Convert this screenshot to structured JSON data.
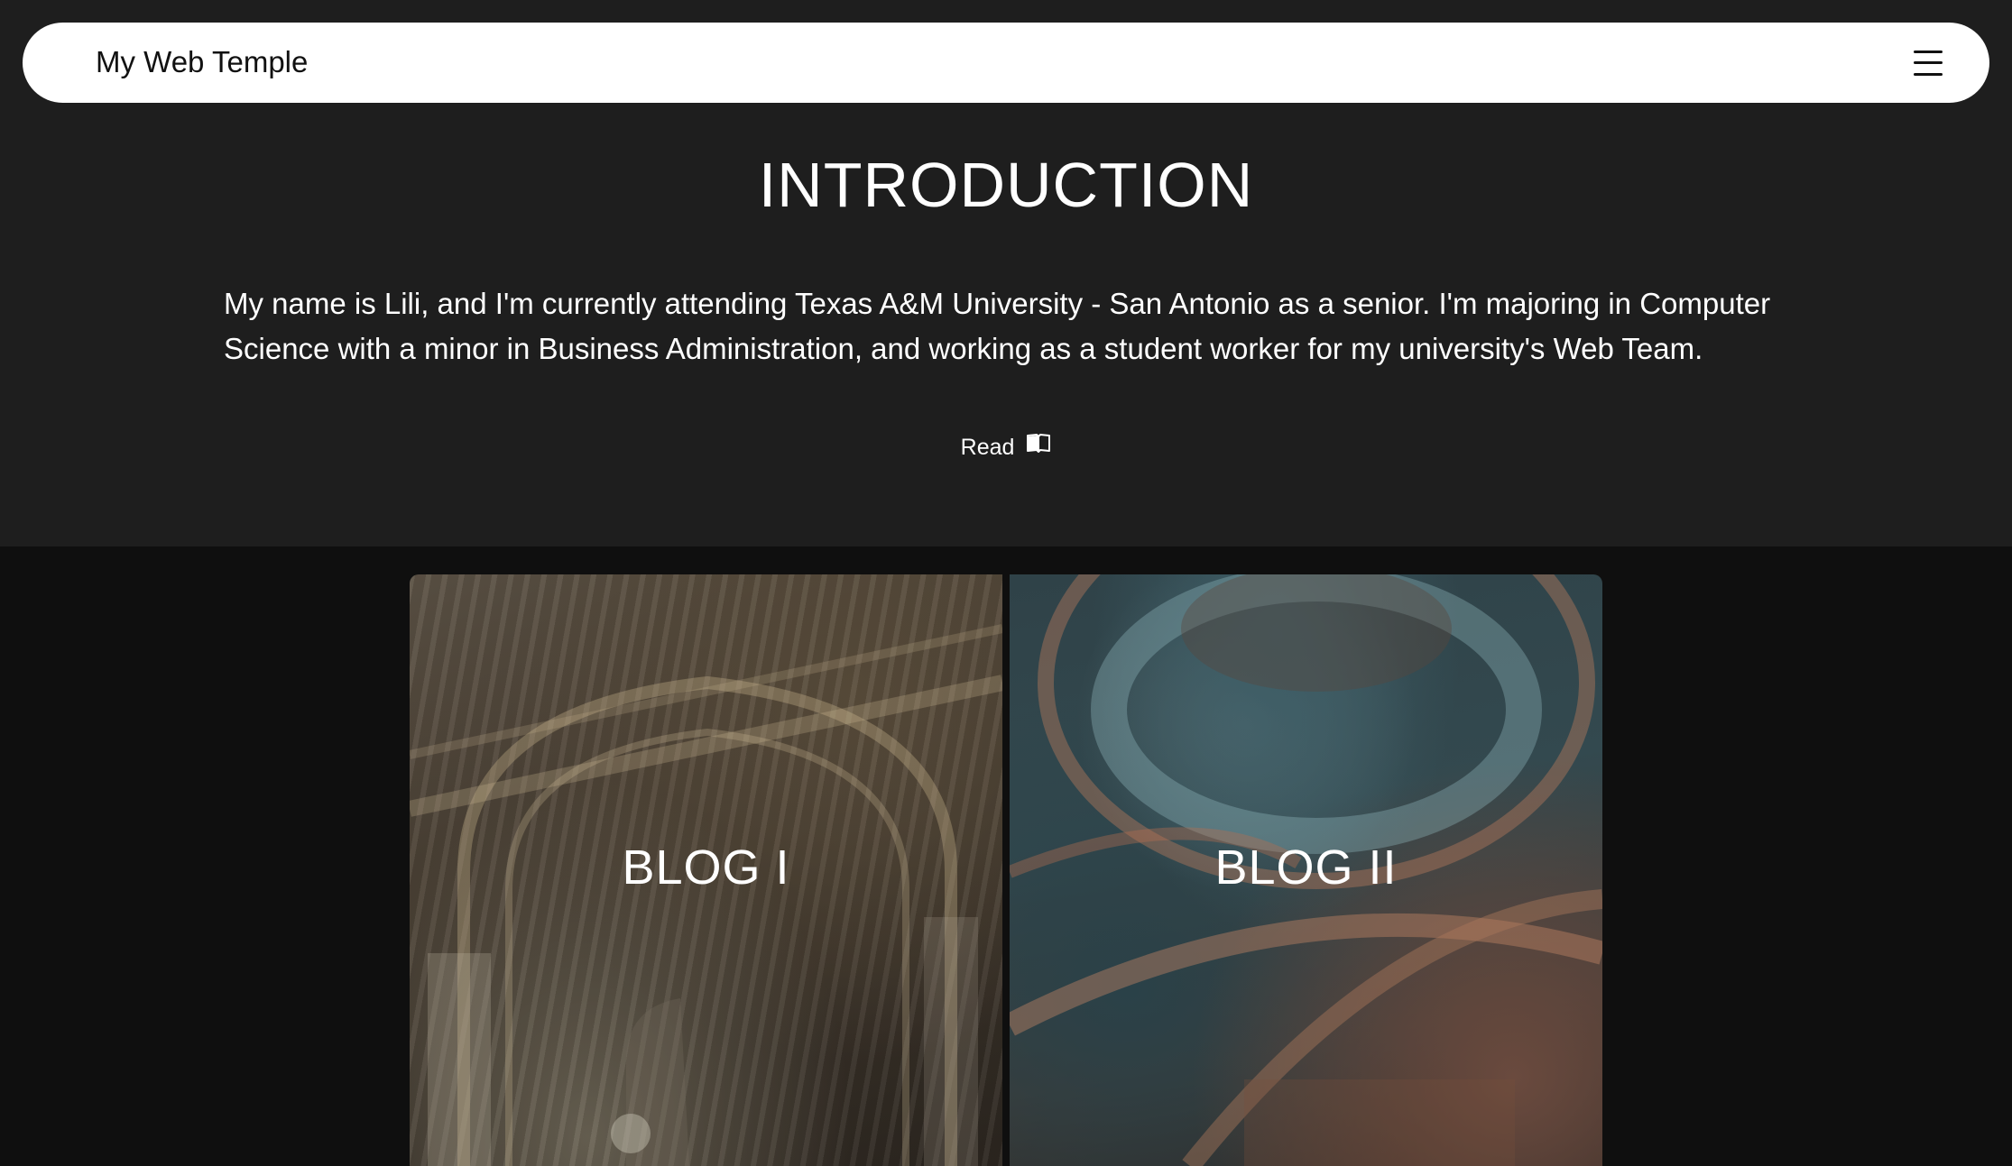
{
  "navbar": {
    "brand": "My Web Temple",
    "menu_icon": "hamburger-menu-icon"
  },
  "intro": {
    "title": "INTRODUCTION",
    "text": "My name is Lili, and I'm currently attending Texas A&M University - San Antonio as a senior. I'm majoring in Computer Science with a minor in Business Administration, and working as a student worker for my university's Web Team.",
    "read_label": "Read",
    "read_icon": "open-book-icon"
  },
  "blogs": [
    {
      "label": "BLOG I"
    },
    {
      "label": "BLOG II"
    }
  ],
  "colors": {
    "page_bg": "#1e1e1e",
    "lower_bg": "#0f0f0f",
    "navbar_bg": "#ffffff",
    "text": "#ffffff"
  }
}
